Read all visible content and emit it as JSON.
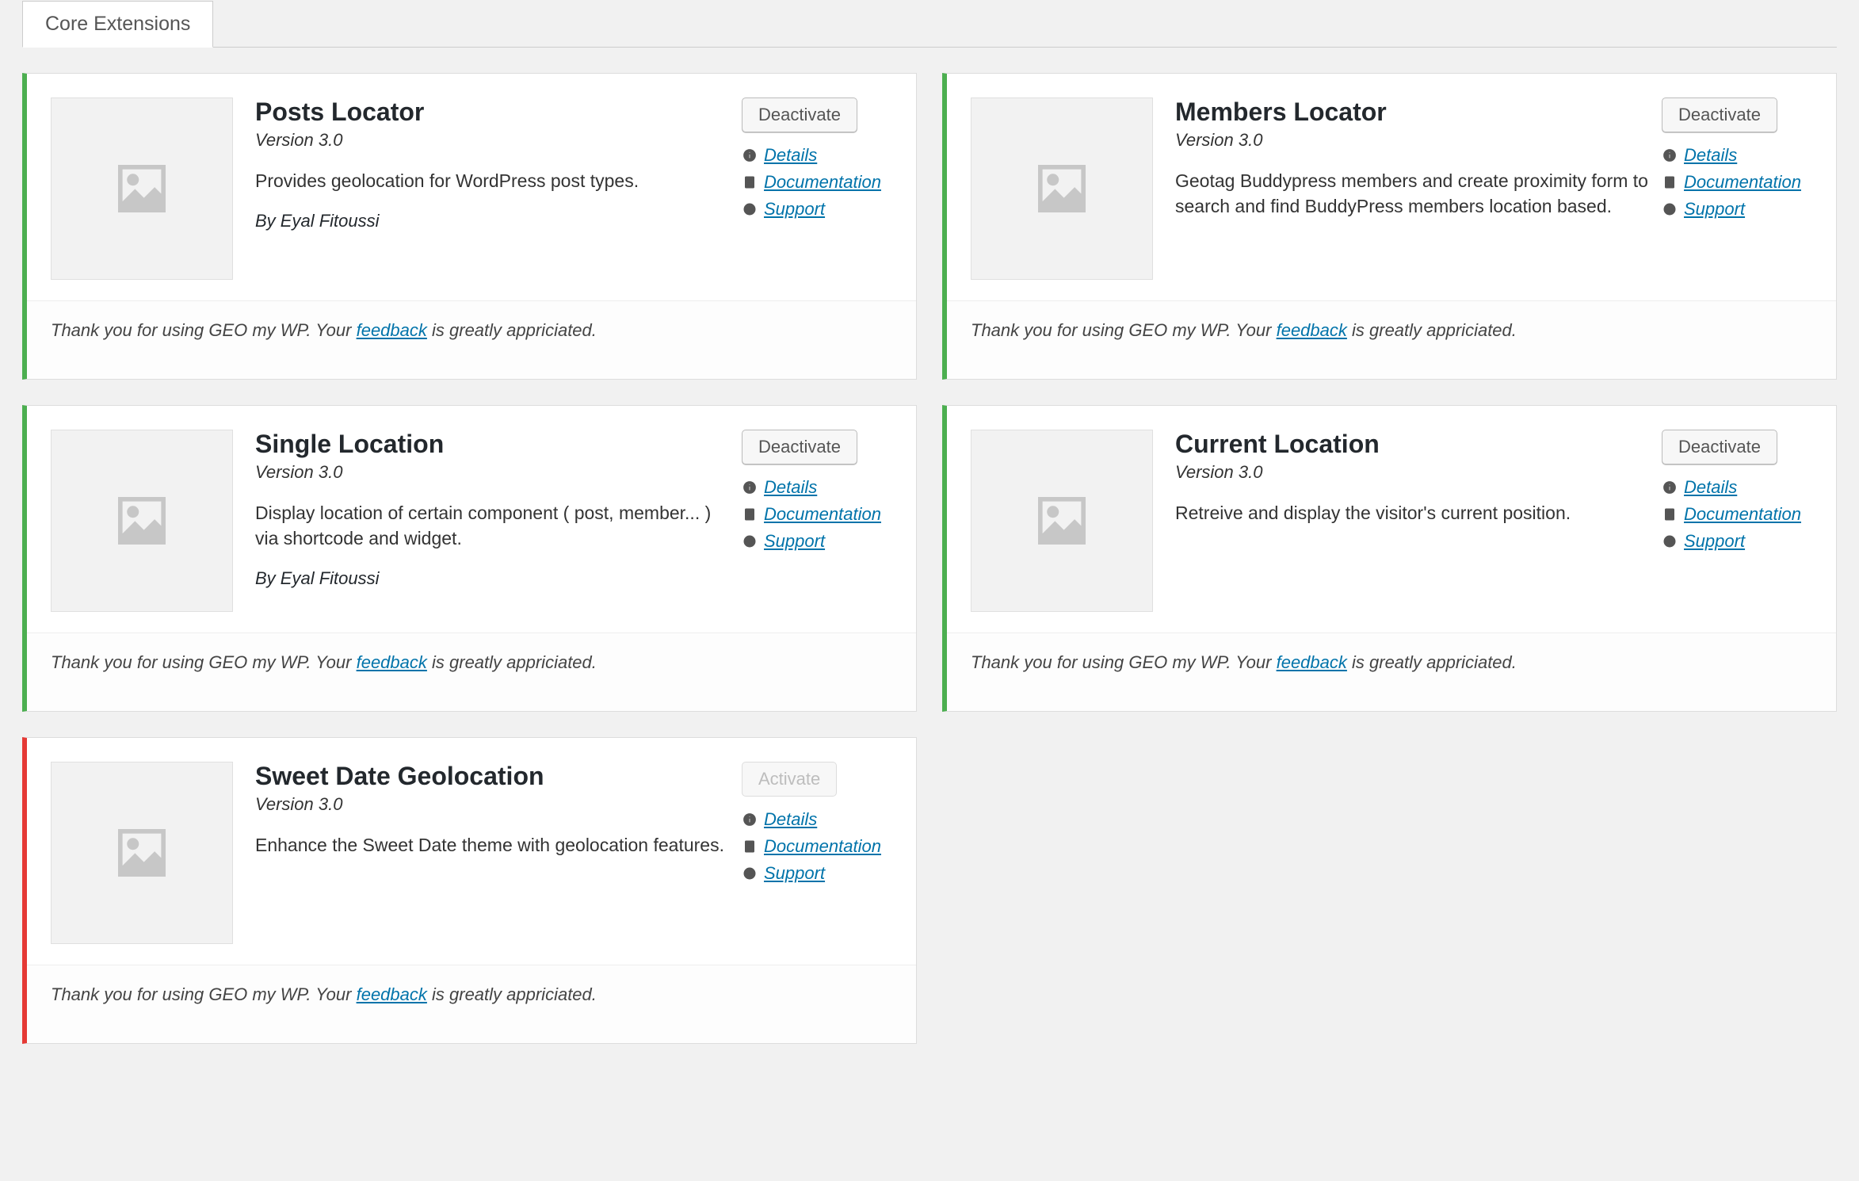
{
  "tabs": {
    "active": "Core Extensions"
  },
  "footer": {
    "prefix": "Thank you for using GEO my WP. Your ",
    "link": "feedback",
    "suffix": " is greatly appriciated."
  },
  "link_labels": {
    "details": "Details",
    "docs": "Documentation",
    "support": "Support"
  },
  "cards": [
    {
      "title": "Posts Locator",
      "version": "Version 3.0",
      "desc": "Provides geolocation for WordPress post types.",
      "author": "By Eyal Fitoussi",
      "action": "Deactivate",
      "state": "active",
      "show_author": true
    },
    {
      "title": "Members Locator",
      "version": "Version 3.0",
      "desc": "Geotag Buddypress members and create proximity form to search and find BuddyPress members location based.",
      "author": "",
      "action": "Deactivate",
      "state": "active",
      "show_author": false
    },
    {
      "title": "Single Location",
      "version": "Version 3.0",
      "desc": "Display location of certain component ( post, member... ) via shortcode and widget.",
      "author": "By Eyal Fitoussi",
      "action": "Deactivate",
      "state": "active",
      "show_author": true
    },
    {
      "title": "Current Location",
      "version": "Version 3.0",
      "desc": "Retreive and display the visitor's current position.",
      "author": "",
      "action": "Deactivate",
      "state": "active",
      "show_author": false
    },
    {
      "title": "Sweet Date Geolocation",
      "version": "Version 3.0",
      "desc": "Enhance the Sweet Date theme with geolocation features.",
      "author": "",
      "action": "Activate",
      "state": "inactive",
      "show_author": false
    }
  ]
}
